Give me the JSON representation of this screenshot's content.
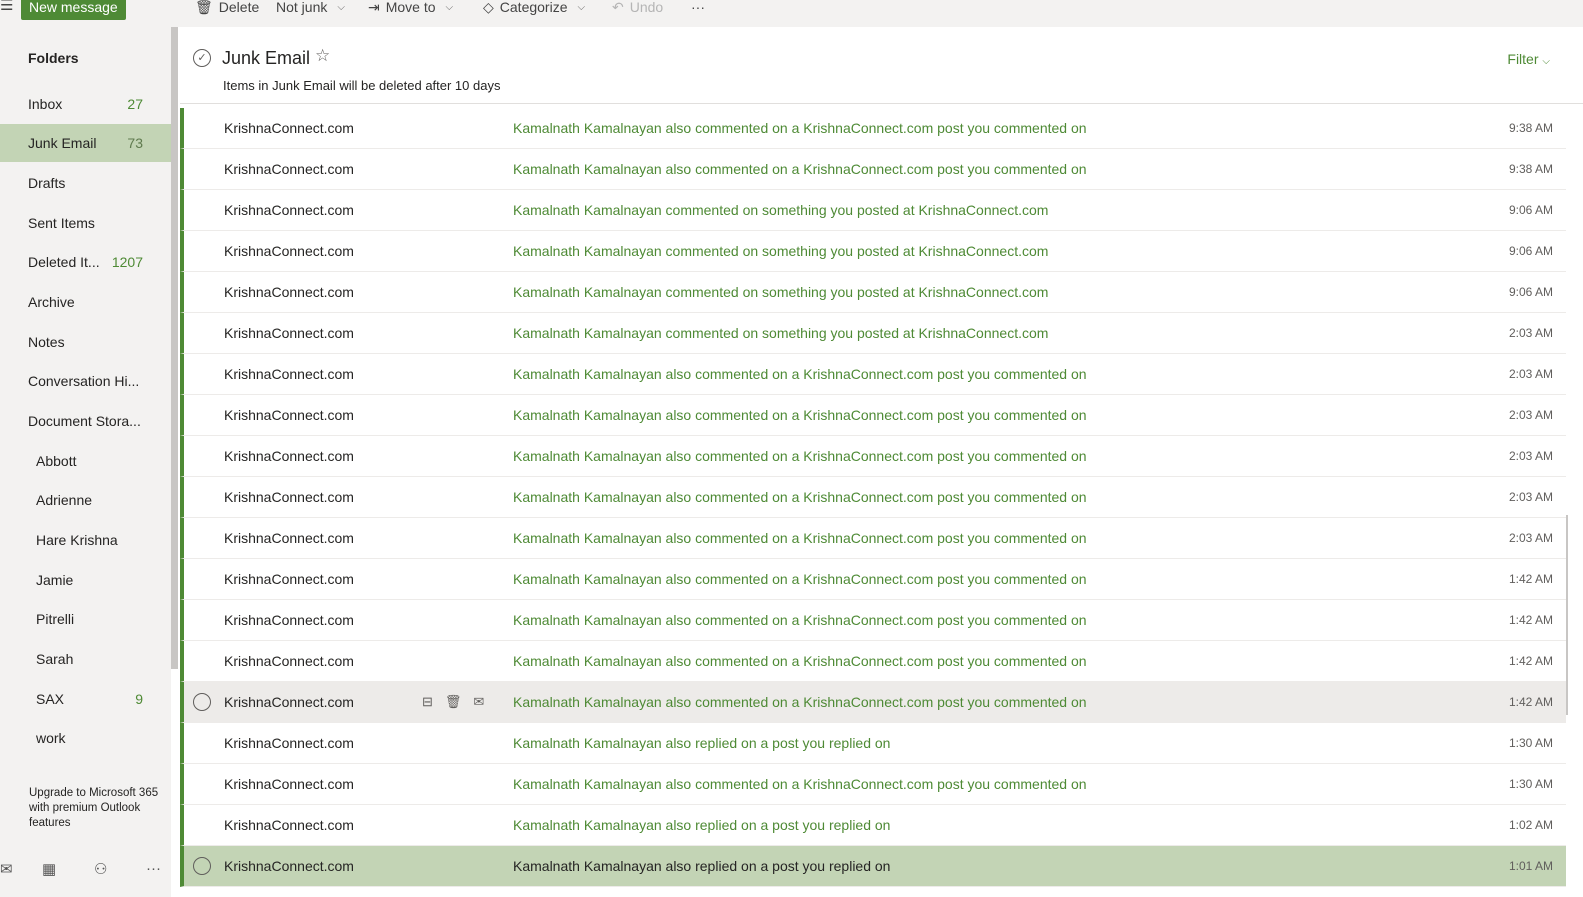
{
  "toolbar": {
    "new_message": "New message",
    "delete": "Delete",
    "not_junk": "Not junk",
    "move_to": "Move to",
    "categorize": "Categorize",
    "undo": "Undo",
    "more": "···"
  },
  "sidebar": {
    "folders_heading": "Folders",
    "folders": [
      {
        "label": "Inbox",
        "count": "27"
      },
      {
        "label": "Junk Email",
        "count": "73"
      },
      {
        "label": "Drafts",
        "count": ""
      },
      {
        "label": "Sent Items",
        "count": ""
      },
      {
        "label": "Deleted It...",
        "count": "1207"
      },
      {
        "label": "Archive",
        "count": ""
      },
      {
        "label": "Notes",
        "count": ""
      },
      {
        "label": "Conversation Hi...",
        "count": ""
      },
      {
        "label": "Document Stora...",
        "count": ""
      },
      {
        "label": "Abbott",
        "count": ""
      },
      {
        "label": "Adrienne",
        "count": ""
      },
      {
        "label": "Hare Krishna",
        "count": ""
      },
      {
        "label": "Jamie",
        "count": ""
      },
      {
        "label": "Pitrelli",
        "count": ""
      },
      {
        "label": "Sarah",
        "count": ""
      },
      {
        "label": "SAX",
        "count": "9"
      },
      {
        "label": "work",
        "count": ""
      }
    ],
    "upgrade_text": "Upgrade to Microsoft 365 with premium Outlook features"
  },
  "list": {
    "title": "Junk Email",
    "notice": "Items in Junk Email will be deleted after 10 days",
    "filter": "Filter"
  },
  "messages": [
    {
      "sender": "KrishnaConnect.com",
      "subject": "Kamalnath Kamalnayan also commented on a KrishnaConnect.com post you commented on",
      "time": "9:38 AM"
    },
    {
      "sender": "KrishnaConnect.com",
      "subject": "Kamalnath Kamalnayan also commented on a KrishnaConnect.com post you commented on",
      "time": "9:38 AM"
    },
    {
      "sender": "KrishnaConnect.com",
      "subject": "Kamalnath Kamalnayan commented on something you posted at KrishnaConnect.com",
      "time": "9:06 AM"
    },
    {
      "sender": "KrishnaConnect.com",
      "subject": "Kamalnath Kamalnayan commented on something you posted at KrishnaConnect.com",
      "time": "9:06 AM"
    },
    {
      "sender": "KrishnaConnect.com",
      "subject": "Kamalnath Kamalnayan commented on something you posted at KrishnaConnect.com",
      "time": "9:06 AM"
    },
    {
      "sender": "KrishnaConnect.com",
      "subject": "Kamalnath Kamalnayan commented on something you posted at KrishnaConnect.com",
      "time": "2:03 AM"
    },
    {
      "sender": "KrishnaConnect.com",
      "subject": "Kamalnath Kamalnayan also commented on a KrishnaConnect.com post you commented on",
      "time": "2:03 AM"
    },
    {
      "sender": "KrishnaConnect.com",
      "subject": "Kamalnath Kamalnayan also commented on a KrishnaConnect.com post you commented on",
      "time": "2:03 AM"
    },
    {
      "sender": "KrishnaConnect.com",
      "subject": "Kamalnath Kamalnayan also commented on a KrishnaConnect.com post you commented on",
      "time": "2:03 AM"
    },
    {
      "sender": "KrishnaConnect.com",
      "subject": "Kamalnath Kamalnayan also commented on a KrishnaConnect.com post you commented on",
      "time": "2:03 AM"
    },
    {
      "sender": "KrishnaConnect.com",
      "subject": "Kamalnath Kamalnayan also commented on a KrishnaConnect.com post you commented on",
      "time": "2:03 AM"
    },
    {
      "sender": "KrishnaConnect.com",
      "subject": "Kamalnath Kamalnayan also commented on a KrishnaConnect.com post you commented on",
      "time": "1:42 AM"
    },
    {
      "sender": "KrishnaConnect.com",
      "subject": "Kamalnath Kamalnayan also commented on a KrishnaConnect.com post you commented on",
      "time": "1:42 AM"
    },
    {
      "sender": "KrishnaConnect.com",
      "subject": "Kamalnath Kamalnayan also commented on a KrishnaConnect.com post you commented on",
      "time": "1:42 AM"
    },
    {
      "sender": "KrishnaConnect.com",
      "subject": "Kamalnath Kamalnayan also commented on a KrishnaConnect.com post you commented on",
      "time": "1:42 AM",
      "state": "hover"
    },
    {
      "sender": "KrishnaConnect.com",
      "subject": "Kamalnath Kamalnayan also replied on a post you replied on",
      "time": "1:30 AM"
    },
    {
      "sender": "KrishnaConnect.com",
      "subject": "Kamalnath Kamalnayan also commented on a KrishnaConnect.com post you commented on",
      "time": "1:30 AM"
    },
    {
      "sender": "KrishnaConnect.com",
      "subject": "Kamalnath Kamalnayan also replied on a post you replied on",
      "time": "1:02 AM"
    },
    {
      "sender": "KrishnaConnect.com",
      "subject": "Kamalnath Kamalnayan also replied on a post you replied on",
      "time": "1:01 AM",
      "state": "selected"
    }
  ]
}
